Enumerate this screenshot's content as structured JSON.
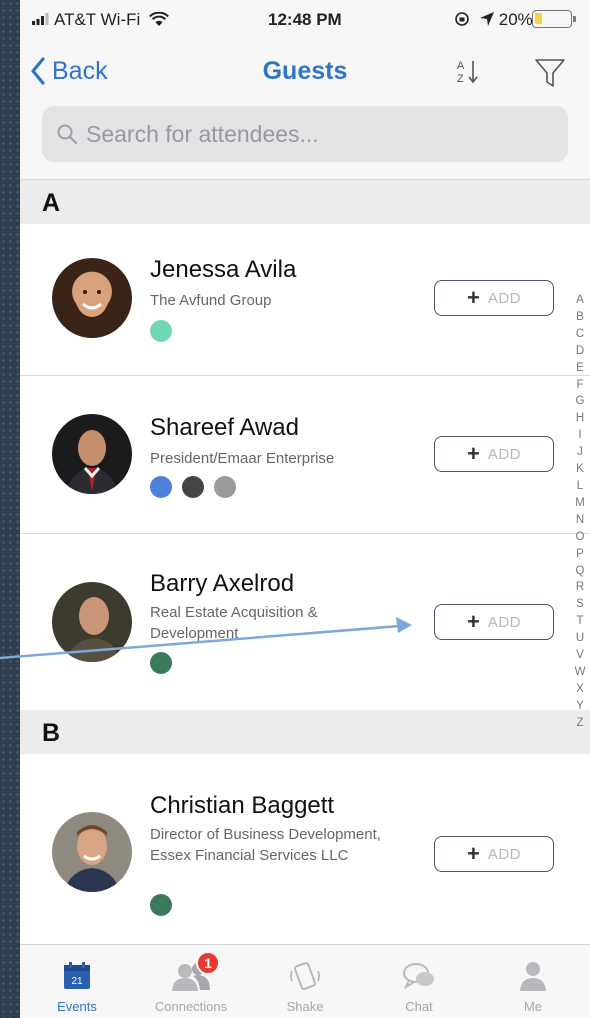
{
  "status_bar": {
    "carrier": "AT&T Wi-Fi",
    "time": "12:48 PM",
    "battery_percent": "20%",
    "battery_level": 0.2,
    "icons": [
      "signal-icon",
      "wifi-icon",
      "location-icon",
      "lock-rotation-icon",
      "battery-icon"
    ]
  },
  "nav": {
    "back_label": "Back",
    "title": "Guests",
    "icons": [
      "chevron-left-icon",
      "sort-az-icon",
      "filter-icon"
    ]
  },
  "search": {
    "placeholder": "Search for attendees...",
    "value": ""
  },
  "sections": [
    {
      "letter": "A",
      "guests": [
        {
          "name": "Jenessa Avila",
          "company": "The Avfund Group",
          "tags": [
            "#6fd8b0"
          ],
          "add_label": "ADD"
        },
        {
          "name": "Shareef Awad",
          "company": "President/Emaar Enterprise",
          "tags": [
            "#4f7fdc",
            "#444444",
            "#9a9a9a"
          ],
          "add_label": "ADD"
        },
        {
          "name": "Barry Axelrod",
          "company": "Real Estate Acquisition & Development",
          "tags": [
            "#3a7a5c"
          ],
          "add_label": "ADD"
        }
      ]
    },
    {
      "letter": "B",
      "guests": [
        {
          "name": "Christian Baggett",
          "company": "Director of Business Development, Essex Financial Services LLC",
          "tags": [
            "#3a7a5c"
          ],
          "add_label": "ADD"
        }
      ]
    }
  ],
  "alpha_index": [
    "A",
    "B",
    "C",
    "D",
    "E",
    "F",
    "G",
    "H",
    "I",
    "J",
    "K",
    "L",
    "M",
    "N",
    "O",
    "P",
    "Q",
    "R",
    "S",
    "T",
    "U",
    "V",
    "W",
    "X",
    "Y",
    "Z"
  ],
  "tab_bar": {
    "tabs": [
      {
        "label": "Events",
        "icon": "calendar-icon",
        "calendar_day": "21",
        "active": true
      },
      {
        "label": "Connections",
        "icon": "people-icon",
        "badge": "1",
        "active": false
      },
      {
        "label": "Shake",
        "icon": "shake-phone-icon",
        "active": false
      },
      {
        "label": "Chat",
        "icon": "chat-bubbles-icon",
        "active": false
      },
      {
        "label": "Me",
        "icon": "person-icon",
        "active": false
      }
    ]
  },
  "colors": {
    "accent": "#2f74c9",
    "badge": "#e8392f",
    "annotation_arrow": "#7fa7dd"
  }
}
